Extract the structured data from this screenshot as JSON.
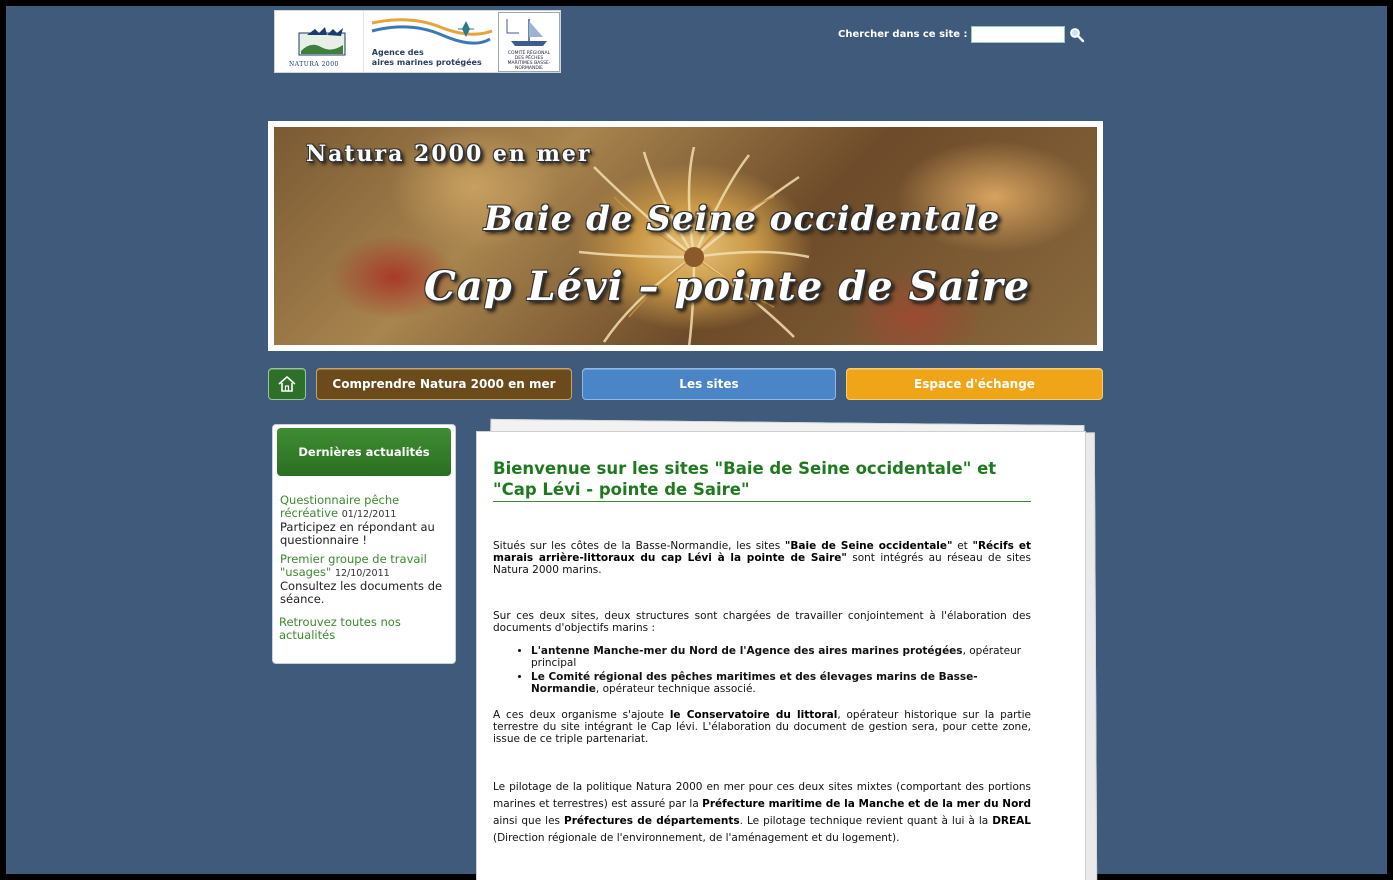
{
  "logos": {
    "natura_caption": "NATURA 2000",
    "aamp_line1": "Agence des",
    "aamp_line2": "aires marines protégées",
    "crpm_text": "COMITÉ RÉGIONAL DES PÊCHES MARITIMES BASSE-NORMANDIE"
  },
  "search": {
    "label": "Chercher dans ce site :",
    "value": "",
    "icon": "search-icon"
  },
  "banner": {
    "line1": "Natura 2000 en mer",
    "line2": "Baie de Seine occidentale",
    "line3": "Cap Lévi – pointe de Saire"
  },
  "nav": {
    "home_icon": "home-icon",
    "comprendre": "Comprendre Natura 2000 en mer",
    "sites": "Les sites",
    "espace": "Espace d'échange",
    "colors": {
      "home": "#2e6f2a",
      "comprendre": "#6b4a1c",
      "sites": "#4a86c7",
      "espace": "#f0a418"
    }
  },
  "sidebar": {
    "heading": "Dernières actualités",
    "items": [
      {
        "link": "Questionnaire pêche récréative",
        "date": "01/12/2011",
        "text": "Participez en répondant au questionnaire !"
      },
      {
        "link": "Premier groupe de travail \"usages\"",
        "date": "12/10/2011",
        "text": "Consultez les documents de séance."
      }
    ],
    "all_link": "Retrouvez toutes nos actualités"
  },
  "content": {
    "title": "Bienvenue sur les sites \"Baie de Seine occidentale\" et \"Cap Lévi - pointe de Saire\"",
    "p1_a": "Situés sur les côtes de la Basse-Normandie, les sites ",
    "p1_b": "\"Baie de Seine occidentale\"",
    "p1_c": " et ",
    "p1_d": "\"Récifs et marais arrière-littoraux du cap Lévi à la pointe de Saire\"",
    "p1_e": " sont intégrés au réseau de sites Natura 2000 marins.",
    "p2": "Sur ces deux sites, deux structures sont chargées de travailler conjointement à l'élaboration des documents d'objectifs marins :",
    "li1_b": "L'antenne Manche-mer du Nord de l'Agence des aires marines protégées",
    "li1_t": ", opérateur principal",
    "li2_b": "Le Comité régional des pêches maritimes et des élevages marins de Basse-Normandie",
    "li2_t": ", opérateur technique associé.",
    "p3_a": " A ces deux organisme s'ajoute ",
    "p3_b": "le Conservatoire du littoral",
    "p3_c": ", opérateur historique sur la partie terrestre du site intégrant le Cap lévi. L'élaboration du document de gestion sera, pour cette zone, issue de ce triple partenariat.",
    "p4_a": " Le pilotage de la politique Natura 2000 en mer pour ces deux sites mixtes (comportant des portions marines et terrestres) est assuré par la ",
    "p4_b": "Préfecture maritime de la Manche et de la mer du Nord",
    "p4_c": " ainsi que les ",
    "p4_d": "Préfectures de départements",
    "p4_e": ". Le pilotage technique revient quant à lui à la ",
    "p4_f": "DREAL",
    "p4_g": " (Direction régionale de l'environnement, de l'aménagement et du logement)."
  }
}
